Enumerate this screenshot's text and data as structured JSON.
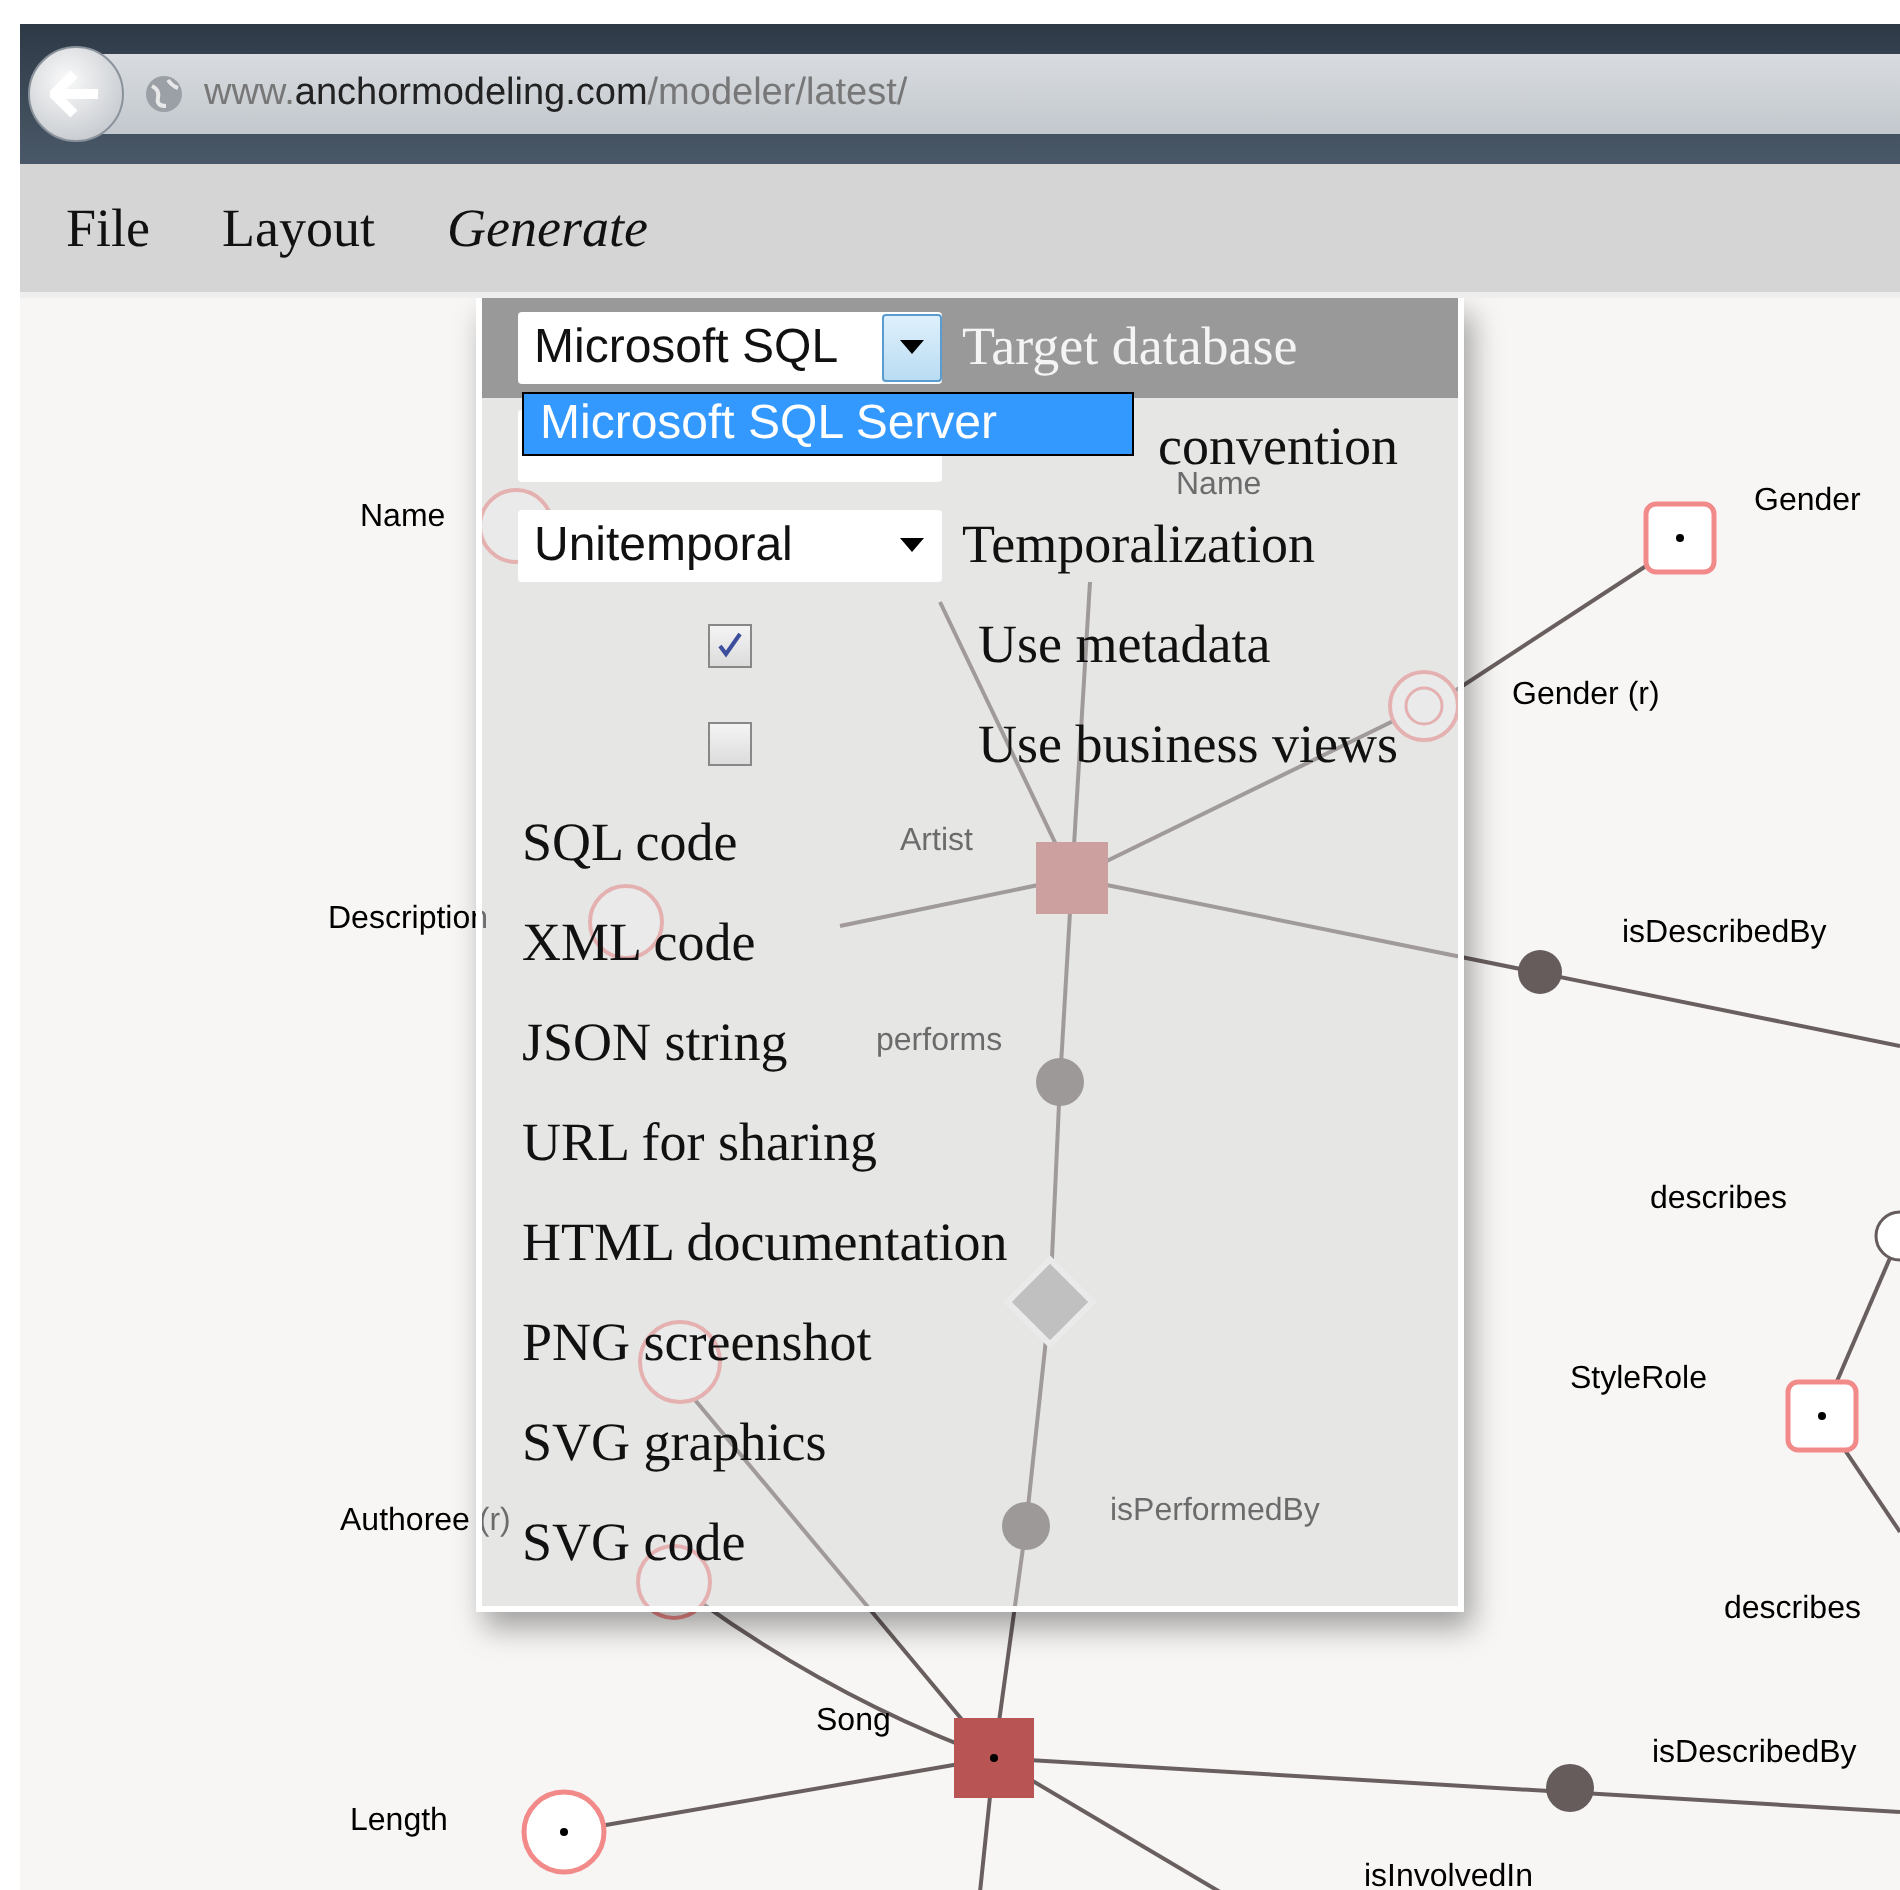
{
  "browser": {
    "url_prefix": "www.",
    "url_domain": "anchormodeling.com",
    "url_path": "/modeler/latest/"
  },
  "menubar": [
    {
      "label": "File",
      "selected": false
    },
    {
      "label": "Layout",
      "selected": false
    },
    {
      "label": "Generate",
      "selected": true
    }
  ],
  "generate_menu": {
    "settings": [
      {
        "kind": "select",
        "value": "Microsoft SQL",
        "label": "Target database",
        "highlighted": true,
        "open": true,
        "options": [
          {
            "label": "Microsoft SQL Server",
            "selected": true
          }
        ]
      },
      {
        "kind": "select",
        "label": "convention",
        "highlighted": false,
        "partly_covered": true
      },
      {
        "kind": "select",
        "value": "Unitemporal",
        "label": "Temporalization",
        "highlighted": false,
        "open": false
      },
      {
        "kind": "checkbox",
        "label": "Use metadata",
        "checked": true,
        "highlighted": false
      },
      {
        "kind": "checkbox",
        "label": "Use business views",
        "checked": false,
        "highlighted": false
      }
    ],
    "actions": [
      "SQL code",
      "XML code",
      "JSON string",
      "URL for sharing",
      "HTML documentation",
      "PNG screenshot",
      "SVG graphics",
      "SVG code"
    ]
  },
  "diagram": {
    "labels": [
      "Gender",
      "Name",
      "Name",
      "Gender (r)",
      "Artist",
      "Description",
      "isDescribedBy",
      "performs",
      "describes",
      "StyleRole",
      "Authoree (r)",
      "isPerformedBy",
      "describes",
      "Song",
      "isDescribedBy",
      "Length",
      "isInvolvedIn"
    ]
  }
}
